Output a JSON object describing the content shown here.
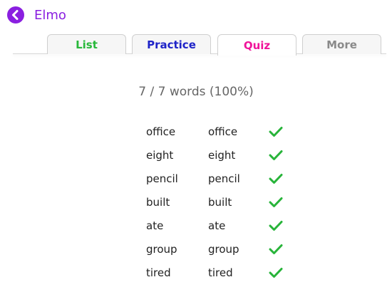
{
  "header": {
    "title": "Elmo",
    "accent_color": "#8a1fe0",
    "back_icon": "back-arrow-circle-icon"
  },
  "tabs": [
    {
      "label": "List",
      "color": "#27b83a",
      "active": false
    },
    {
      "label": "Practice",
      "color": "#1f24c8",
      "active": false
    },
    {
      "label": "Quiz",
      "color": "#f0149a",
      "active": true
    },
    {
      "label": "More",
      "color": "#8a8a8a",
      "active": false
    }
  ],
  "quiz": {
    "score_text": "7 / 7 words (100%)",
    "check_color": "#28b43a",
    "check_icon": "checkmark-icon",
    "results": [
      {
        "word": "office",
        "answer": "office",
        "correct": true
      },
      {
        "word": "eight",
        "answer": "eight",
        "correct": true
      },
      {
        "word": "pencil",
        "answer": "pencil",
        "correct": true
      },
      {
        "word": "built",
        "answer": "built",
        "correct": true
      },
      {
        "word": "ate",
        "answer": "ate",
        "correct": true
      },
      {
        "word": "group",
        "answer": "group",
        "correct": true
      },
      {
        "word": "tired",
        "answer": "tired",
        "correct": true
      }
    ]
  }
}
